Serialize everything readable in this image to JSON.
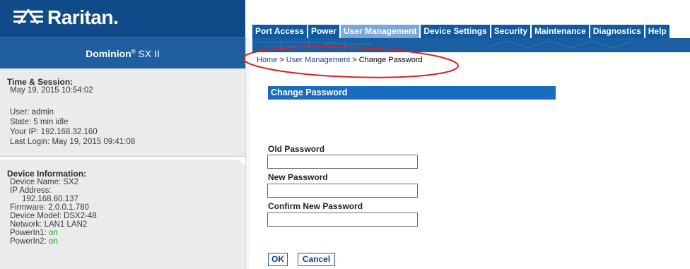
{
  "brand": {
    "logo_text": "Raritan.",
    "product_name": "Dominion",
    "product_reg": "®",
    "product_suffix": " SX II"
  },
  "session": {
    "title": "Time & Session:",
    "datetime": "May 19, 2015 10:54:02",
    "user": "User: admin",
    "state": "State: 5 min idle",
    "your_ip": "Your IP: 192.168.32.160",
    "last_login": "Last Login: May 19, 2015 09:41:08"
  },
  "device": {
    "title": "Device Information:",
    "name": "Device Name: SX2",
    "ip_label": "IP Address:",
    "ip_value": "192.168.60.137",
    "firmware": "Firmware: 2.0.0.1.780",
    "model": "Device Model: DSX2-48",
    "network": "Network: LAN1 LAN2",
    "power1_label": "PowerIn1: ",
    "power1_value": "on",
    "power2_label": "PowerIn2: ",
    "power2_value": "on"
  },
  "nav": {
    "tabs": [
      {
        "label": "Port Access"
      },
      {
        "label": "Power"
      },
      {
        "label": "User Management"
      },
      {
        "label": "Device Settings"
      },
      {
        "label": "Security"
      },
      {
        "label": "Maintenance"
      },
      {
        "label": "Diagnostics"
      },
      {
        "label": "Help"
      }
    ],
    "active_tab": "User Management"
  },
  "breadcrumb": {
    "home": "Home",
    "section": "User Management",
    "current": "Change Password",
    "separator": ">"
  },
  "form": {
    "header": "Change Password",
    "old_label": "Old Password",
    "old_value": "",
    "new_label": "New Password",
    "new_value": "",
    "confirm_label": "Confirm New Password",
    "confirm_value": "",
    "ok_label": "OK",
    "cancel_label": "Cancel"
  },
  "colors": {
    "brand_dark_blue": "#0f4a89",
    "nav_blue": "#0f5aa0",
    "nav_active": "#7aa7d8",
    "header_blue": "#1a6cc0",
    "highlight_red": "#d92020",
    "status_on": "#1f9b1f"
  }
}
